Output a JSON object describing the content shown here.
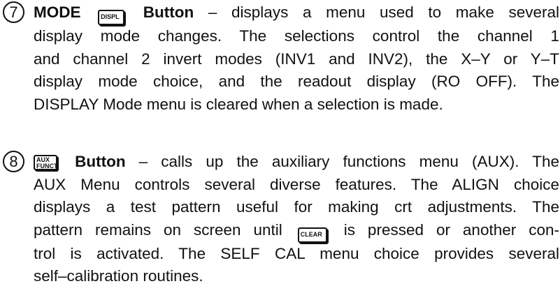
{
  "items": [
    {
      "number": "7",
      "label": "MODE",
      "key_label": "DISPL",
      "key_suffix": "Button",
      "dash": " – ",
      "line1_rest": "displays a menu used to make several",
      "line2": "display mode changes. The selections control the channel 1",
      "line3": "and channel 2 invert modes (INV1 and INV2), the X–Y or Y–T",
      "line4": "display mode choice, and the readout display (RO OFF). The",
      "line5": "DISPLAY Mode menu is cleared when a selection is made."
    },
    {
      "number": "8",
      "key_line1": "AUX",
      "key_line2": "FUNCT",
      "key_suffix": "Button",
      "dash": " – ",
      "line1_rest": "calls up the auxiliary functions menu (AUX). The",
      "line2": "AUX Menu controls several diverse features. The ALIGN choice",
      "line3": "displays a test pattern useful for making crt adjustments. The",
      "line4_pre": "pattern remains on screen until",
      "clear_key": "CLEAR",
      "line4_post": "is pressed or another con-",
      "line5": "trol is activated. The SELF CAL menu choice provides several",
      "line6": "self–calibration routines."
    }
  ]
}
